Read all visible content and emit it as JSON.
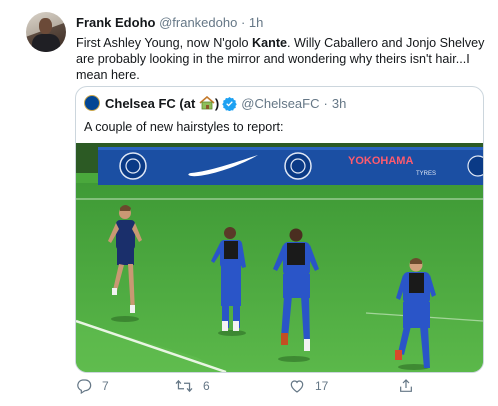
{
  "tweet": {
    "author_name": "Frank Edoho",
    "author_handle": "@frankedoho",
    "separator": "·",
    "time": "1h",
    "text_part1": "First Ashley Young, now N'golo ",
    "text_bold": "Kante",
    "text_part2": ". Willy Caballero and Jonjo Shelvey are probably looking in the mirror and wondering why theirs isn't hair...I mean here.",
    "replies": "7",
    "retweets": "6",
    "likes": "17"
  },
  "quoted_tweet": {
    "author_name_prefix": "Chelsea FC (at ",
    "author_name_suffix": ")",
    "author_handle": "@ChelseaFC",
    "separator": "·",
    "time": "3h",
    "text": "A couple of new hairstyles to report:",
    "image": {
      "sponsor_text": "YOKOHAMA",
      "sponsor_subtext": "TYRES"
    }
  },
  "colors": {
    "accent": "#1da1f2",
    "secondary_text": "#657786",
    "border": "#ccd6dd",
    "chelsea_blue": "#034694",
    "pitch_green": "#4aa83c"
  },
  "icons": [
    "reply-icon",
    "retweet-icon",
    "like-icon",
    "share-icon",
    "verified-icon",
    "house-icon",
    "nike-swoosh-icon",
    "chelsea-crest-icon"
  ]
}
